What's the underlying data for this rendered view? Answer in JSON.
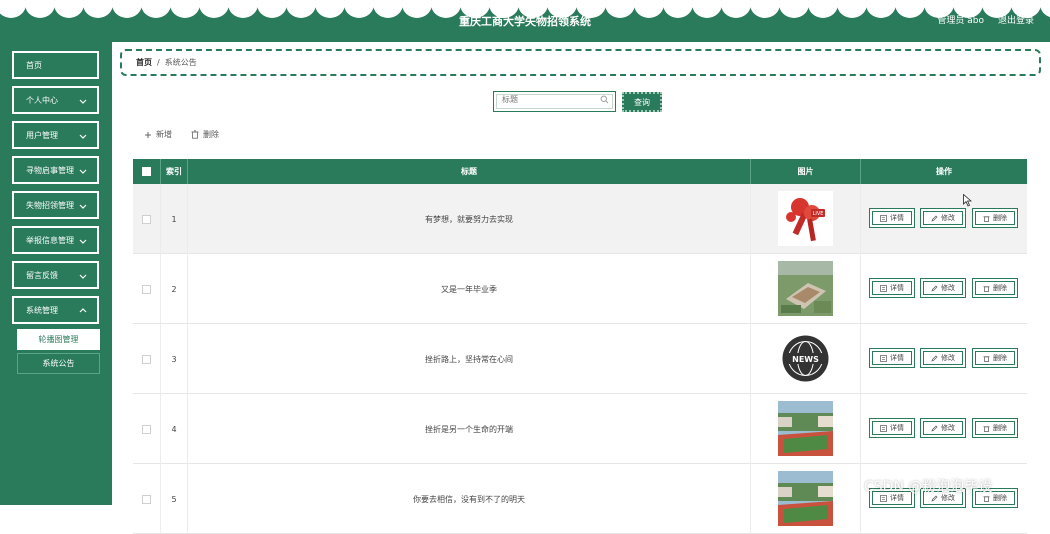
{
  "header": {
    "title": "重庆工商大学失物招领系统",
    "user": "管理员 abo",
    "logout": "退出登录"
  },
  "sidebar": {
    "items": [
      {
        "label": "首页"
      },
      {
        "label": "个人中心"
      },
      {
        "label": "用户管理"
      },
      {
        "label": "寻物启事管理"
      },
      {
        "label": "失物招领管理"
      },
      {
        "label": "举报信息管理"
      },
      {
        "label": "留言反馈"
      },
      {
        "label": "系统管理"
      }
    ],
    "submenu": [
      {
        "label": "轮播图管理"
      },
      {
        "label": "系统公告"
      }
    ]
  },
  "breadcrumb": {
    "home": "首页",
    "separator": "/",
    "current": "系统公告"
  },
  "search": {
    "placeholder": "标题",
    "button": "查询"
  },
  "actions": {
    "add": "新增",
    "delete": "删除"
  },
  "table": {
    "headers": {
      "index": "索引",
      "title": "标题",
      "image": "图片",
      "ops": "操作"
    },
    "op_labels": {
      "detail": "详情",
      "edit": "修改",
      "delete": "删除"
    },
    "rows": [
      {
        "index": "1",
        "title": "有梦想，就要努力去实现",
        "image": "live-microphone"
      },
      {
        "index": "2",
        "title": "又是一年毕业季",
        "image": "campus-aerial"
      },
      {
        "index": "3",
        "title": "挫折路上，坚持常在心间",
        "image": "news-globe"
      },
      {
        "index": "4",
        "title": "挫折是另一个生命的开端",
        "image": "sports-field"
      },
      {
        "index": "5",
        "title": "你要去相信，没有到不了的明天",
        "image": "sports-field"
      }
    ]
  },
  "watermark": "CSDN @粉泡泡毕设",
  "colors": {
    "primary": "#2a7a5c",
    "row_highlight": "#f2f2f2"
  }
}
